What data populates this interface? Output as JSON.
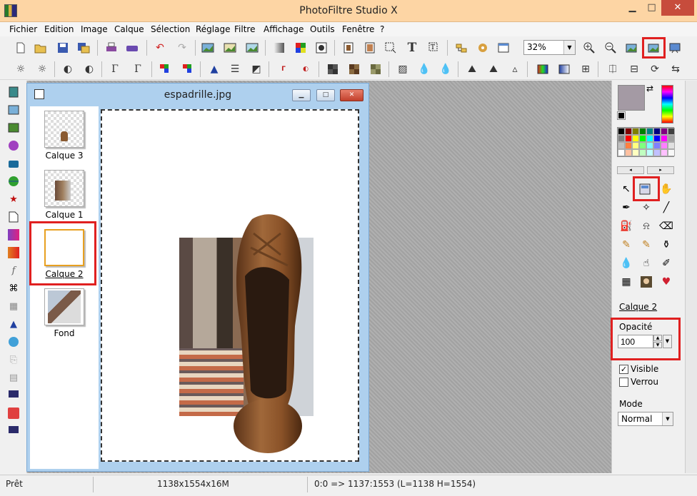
{
  "window": {
    "title": "PhotoFiltre Studio X",
    "min_glyph": "▁",
    "max_glyph": "□",
    "close_glyph": "✕"
  },
  "menu": [
    "Fichier",
    "Edition",
    "Image",
    "Calque",
    "Sélection",
    "Réglage",
    "Filtre",
    "Affichage",
    "Outils",
    "Fenêtre",
    "?"
  ],
  "toolbar": {
    "zoom_value": "32%",
    "text_tool_glyph": "T"
  },
  "document": {
    "title": "espadrille.jpg",
    "layers": [
      {
        "label": "Calque 3"
      },
      {
        "label": "Calque 1"
      },
      {
        "label": "Calque 2"
      },
      {
        "label": "Fond"
      }
    ]
  },
  "right_panel": {
    "current_layer": "Calque 2",
    "opacity_label": "Opacité",
    "opacity_value": "100",
    "visible_label": "Visible",
    "lock_label": "Verrou",
    "mode_label": "Mode",
    "mode_value": "Normal",
    "palette_colors": [
      "#000000",
      "#800000",
      "#808000",
      "#008000",
      "#008080",
      "#000080",
      "#800080",
      "#404040",
      "#808080",
      "#ff0000",
      "#ffff00",
      "#00ff00",
      "#00ffff",
      "#0000ff",
      "#ff00ff",
      "#a0a0a0",
      "#c0c0c0",
      "#ff8040",
      "#ffff80",
      "#80ff80",
      "#80ffff",
      "#8080ff",
      "#ff80ff",
      "#e0e0e0",
      "#ffffff",
      "#ffc0a0",
      "#ffffc0",
      "#c0ffc0",
      "#c0ffff",
      "#c0c0ff",
      "#ffc0ff",
      "#f8f8f8"
    ]
  },
  "status": {
    "state": "Prêt",
    "dimensions": "1138x1554x16M",
    "coords": "0:0 => 1137:1553 (L=1138  H=1554)"
  },
  "colors": {
    "title_bar": "#fdd5a4",
    "highlight": "#e02020",
    "doc_frame": "#aed0ee"
  }
}
